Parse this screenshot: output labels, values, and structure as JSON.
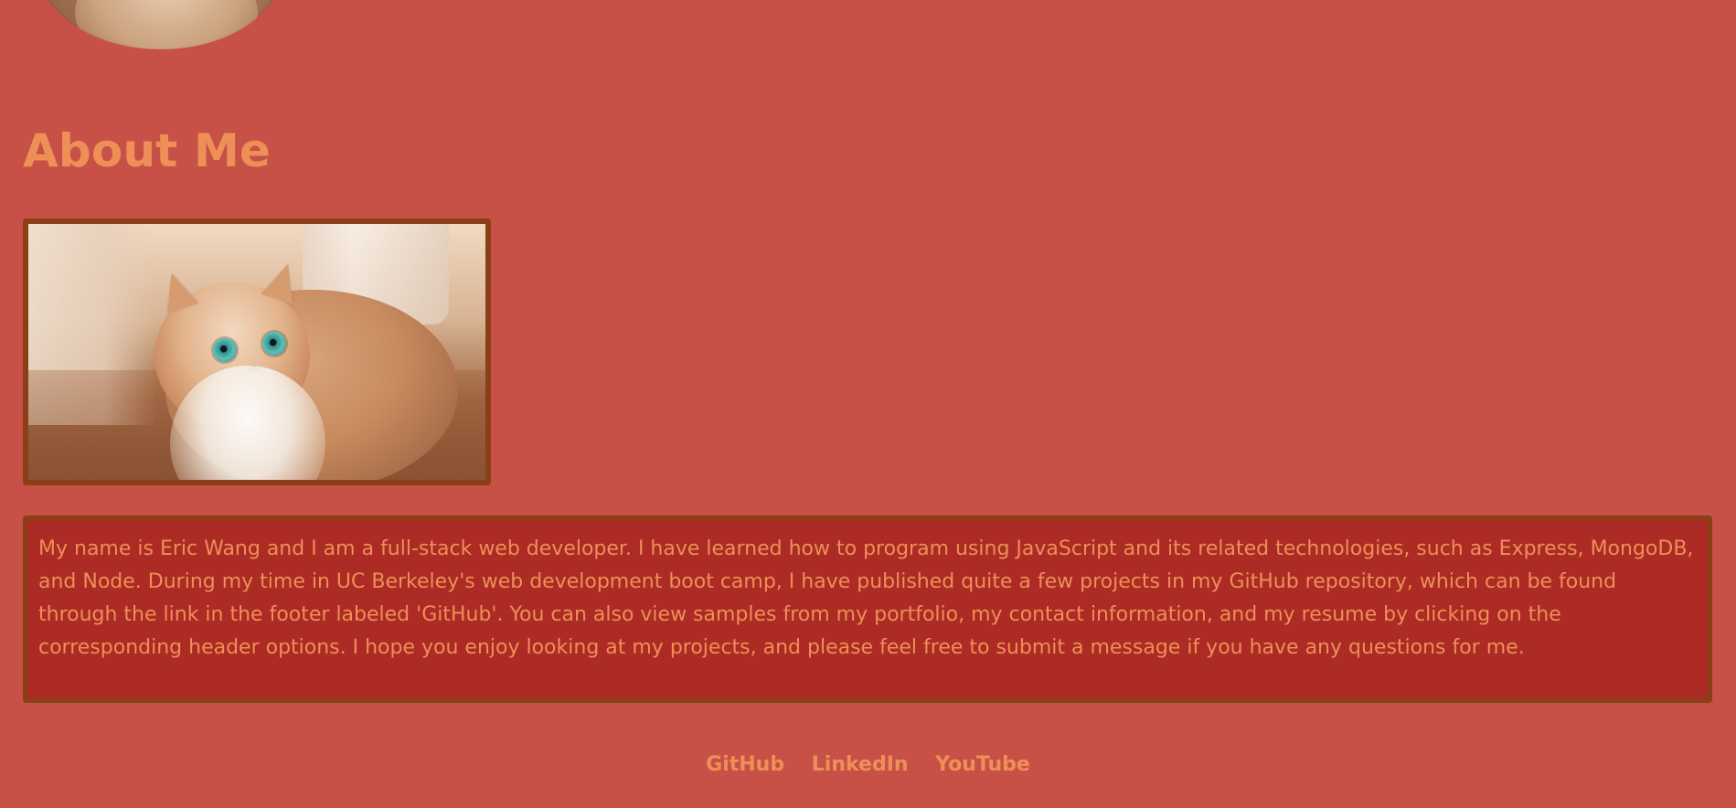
{
  "header": {
    "avatar_name": "profile-avatar"
  },
  "about": {
    "title": "About Me",
    "image_subject": "cat-photo",
    "bio": "My name is Eric Wang and I am a full-stack web developer. I have learned how to program using JavaScript and its related technologies, such as Express, MongoDB, and Node. During my time in UC Berkeley's web development boot camp, I have published quite a few projects in my GitHub repository, which can be found through the link in the footer labeled 'GitHub'. You can also view samples from my portfolio, my contact information, and my resume by clicking on the corresponding header options. I hope you enjoy looking at my projects, and please feel free to submit a message if you have any questions for me."
  },
  "footer": {
    "links": [
      {
        "label": "GitHub"
      },
      {
        "label": "LinkedIn"
      },
      {
        "label": "YouTube"
      }
    ]
  },
  "colors": {
    "page_background": "#c75147",
    "heading": "#ee8f57",
    "bio_background": "#ac2b24",
    "frame_border": "#8a3f17"
  }
}
